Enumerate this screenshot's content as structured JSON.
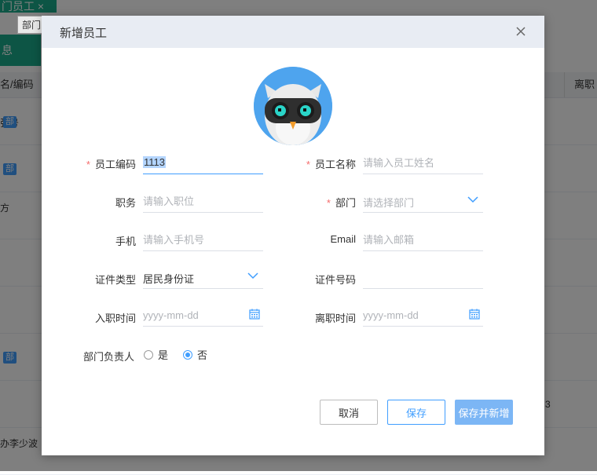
{
  "background": {
    "tab_label": "门员工 ×",
    "tooltip": "部门",
    "sidebar_label": "息",
    "table_header": {
      "col1": "名/编码",
      "col2": "离职"
    },
    "rows": [
      "张号",
      "",
      "方",
      "",
      "",
      "",
      "",
      "办李少波"
    ],
    "badge": "部",
    "right_number": "3"
  },
  "dialog": {
    "title": "新增员工",
    "form": {
      "employee_code": {
        "label": "员工编码",
        "value": "1113",
        "required": true
      },
      "employee_name": {
        "label": "员工名称",
        "placeholder": "请输入员工姓名",
        "required": true
      },
      "position": {
        "label": "职务",
        "placeholder": "请输入职位"
      },
      "department": {
        "label": "部门",
        "placeholder": "请选择部门",
        "required": true
      },
      "phone": {
        "label": "手机",
        "placeholder": "请输入手机号"
      },
      "email": {
        "label": "Email",
        "placeholder": "请输入邮箱"
      },
      "id_type": {
        "label": "证件类型",
        "value": "居民身份证"
      },
      "id_number": {
        "label": "证件号码",
        "value": ""
      },
      "hire_date": {
        "label": "入职时间",
        "placeholder": "yyyy-mm-dd"
      },
      "leave_date": {
        "label": "离职时间",
        "placeholder": "yyyy-mm-dd"
      },
      "dept_head": {
        "label": "部门负责人",
        "options": [
          "是",
          "否"
        ],
        "selected": "否"
      }
    },
    "buttons": {
      "cancel": "取消",
      "save": "保存",
      "save_new": "保存并新增"
    }
  },
  "colors": {
    "accent": "#409eff",
    "required": "#f56c6c",
    "header_bg": "#e8ecf3",
    "teal": "#1aab8a"
  },
  "icons": [
    "close-icon",
    "chevron-down-icon",
    "calendar-icon",
    "owl-avatar"
  ]
}
